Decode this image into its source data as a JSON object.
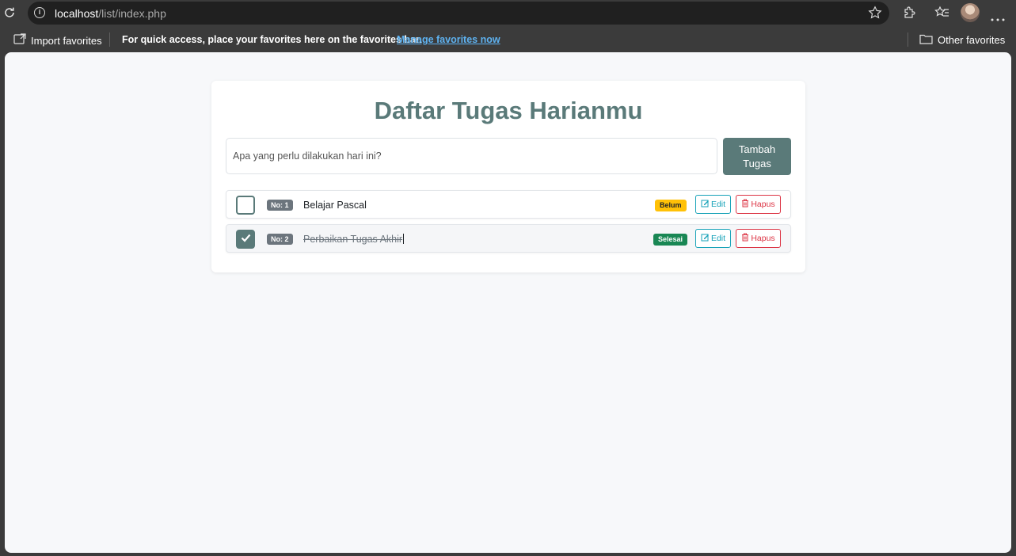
{
  "browser": {
    "url_host": "localhost",
    "url_path": "/list/index.php",
    "favorites_bar": {
      "import_label": "Import favorites",
      "message": "For quick access, place your favorites here on the favorites bar.",
      "manage_link": "Manage favorites now",
      "other_label": "Other favorites"
    }
  },
  "page": {
    "title": "Daftar Tugas Harianmu",
    "input_placeholder": "Apa yang perlu dilakukan hari ini?",
    "add_button_label": "Tambah Tugas",
    "tasks": [
      {
        "number_label": "No: 1",
        "text": "Belajar Pascal",
        "status": "Belum",
        "completed": false,
        "edit_label": "Edit",
        "delete_label": "Hapus"
      },
      {
        "number_label": "No: 2",
        "text": "Perbaikan Tugas Akhir",
        "status": "Selesai",
        "completed": true,
        "edit_label": "Edit",
        "delete_label": "Hapus"
      }
    ]
  },
  "colors": {
    "accent": "#5a7a79",
    "status_pending": "#ffc107",
    "status_done": "#198754",
    "edit": "#17a2b8",
    "delete": "#dc3545"
  },
  "icons": [
    "reload-icon",
    "info-icon",
    "star-icon",
    "extensions-icon",
    "favorites-icon",
    "avatar",
    "more-icon",
    "import-favorites-icon",
    "folder-icon",
    "check-icon",
    "edit-icon",
    "trash-icon"
  ]
}
